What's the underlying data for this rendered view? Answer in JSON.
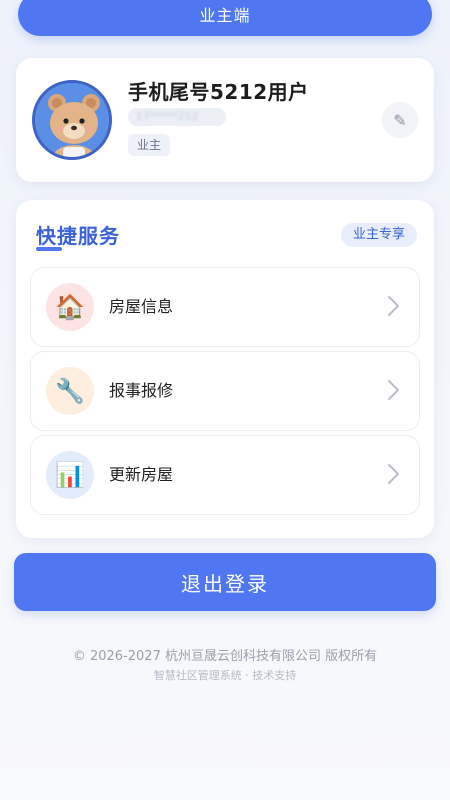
{
  "header": {
    "role_label": "业主端"
  },
  "profile": {
    "username": "手机尾号5212用户",
    "phone_masked": "17*****212",
    "role_badge": "业主",
    "edit_icon": "✎"
  },
  "services": {
    "title": "快捷服务",
    "tag": "业主专享",
    "items": [
      {
        "label": "房屋信息",
        "icon": "house-icon",
        "glyph": "🏠",
        "color": "#fde3e3"
      },
      {
        "label": "报事报修",
        "icon": "wrench-icon",
        "glyph": "🔧",
        "color": "#fdeedd"
      },
      {
        "label": "更新房屋",
        "icon": "chart-icon",
        "glyph": "📊",
        "color": "#e3ecfb"
      }
    ]
  },
  "logout": {
    "label": "退出登录"
  },
  "footer": {
    "copyright": "© 2026-2027 杭州亘晟云创科技有限公司 版权所有",
    "support": "智慧社区管理系统 · 技术支持"
  },
  "colors": {
    "primary": "#4f77f2",
    "title_blue": "#3b63d8"
  }
}
